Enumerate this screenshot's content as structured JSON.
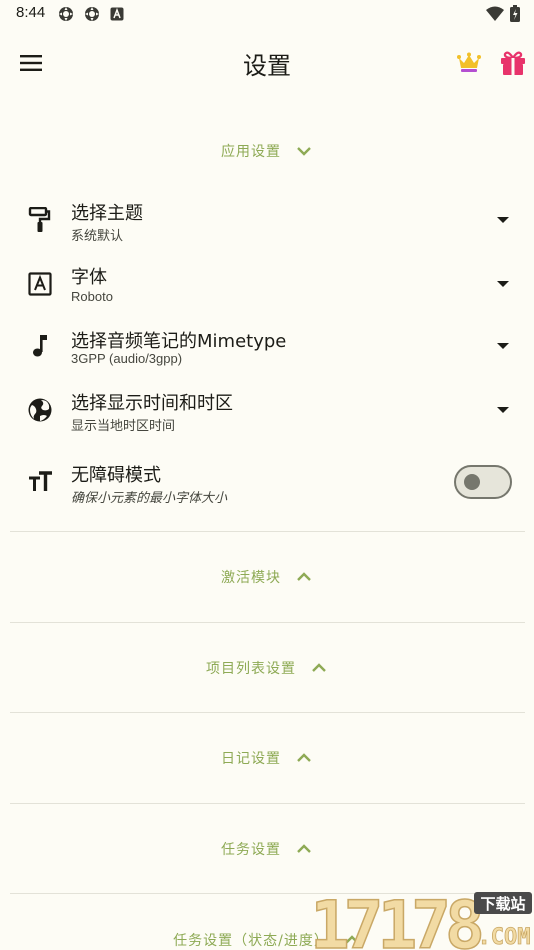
{
  "status_bar": {
    "time": "8:44",
    "left_icons": [
      "settings-gear-icon",
      "settings-gear-icon",
      "text-a-icon"
    ],
    "right_icons": [
      "wifi-icon",
      "battery-icon"
    ]
  },
  "app_bar": {
    "title": "设置",
    "menu_icon": "hamburger-menu-icon",
    "crown_icon": "crown-icon",
    "gift_icon": "gift-icon"
  },
  "colors": {
    "background": "#fdfcf5",
    "accent": "#8eaa55",
    "gift": "#e8336b",
    "crown": "#f2c029"
  },
  "app_settings": {
    "header": "应用设置",
    "expanded": true,
    "items": [
      {
        "title": "选择主题",
        "subtitle": "系统默认",
        "icon": "paint-roller-icon",
        "control": "dropdown"
      },
      {
        "title": "字体",
        "subtitle": "Roboto",
        "icon": "font-a-box-icon",
        "control": "dropdown"
      },
      {
        "title": "选择音频笔记的Mimetype",
        "subtitle": "3GPP (audio/3gpp)",
        "icon": "music-note-icon",
        "control": "dropdown"
      },
      {
        "title": "选择显示时间和时区",
        "subtitle": "显示当地时区时间",
        "icon": "globe-icon",
        "control": "dropdown"
      },
      {
        "title": "无障碍模式",
        "subtitle": "确保小元素的最小字体大小",
        "icon": "text-size-icon",
        "control": "toggle",
        "on": false
      }
    ]
  },
  "sections": [
    {
      "header": "激活模块",
      "expanded": false
    },
    {
      "header": "项目列表设置",
      "expanded": false
    },
    {
      "header": "日记设置",
      "expanded": false
    },
    {
      "header": "任务设置",
      "expanded": false
    },
    {
      "header": "任务设置（状态/进度）",
      "expanded": false
    }
  ],
  "watermark": {
    "text": "17178",
    "badge": "下载站",
    "suffix": ".COM"
  }
}
